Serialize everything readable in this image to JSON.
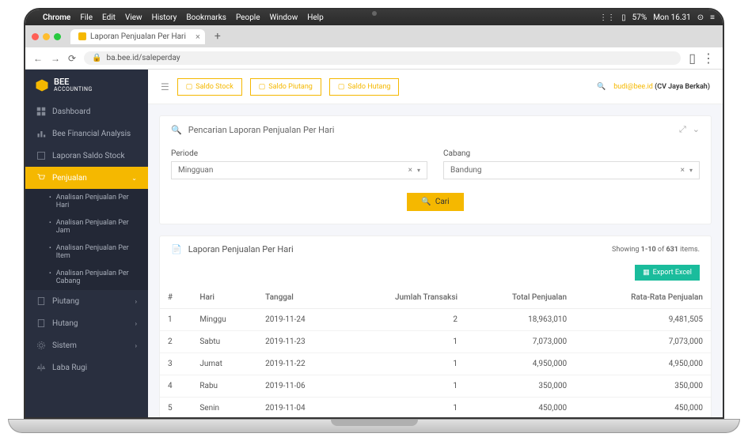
{
  "menubar": {
    "items": [
      "Chrome",
      "File",
      "Edit",
      "View",
      "History",
      "Bookmarks",
      "People",
      "Window",
      "Help"
    ],
    "battery": "57%",
    "time": "Mon 16.31"
  },
  "browser": {
    "tab_title": "Laporan Penjualan Per Hari",
    "url": "ba.bee.id/saleperday"
  },
  "brand": {
    "name": "BEE",
    "sub": "ACCOUNTING"
  },
  "sidebar": {
    "items": [
      {
        "label": "Dashboard"
      },
      {
        "label": "Bee Financial Analysis"
      },
      {
        "label": "Laporan Saldo Stock"
      },
      {
        "label": "Penjualan",
        "active": true,
        "children": [
          {
            "label": "Analisan Penjualan Per Hari"
          },
          {
            "label": "Analisan Penjualan Per Jam"
          },
          {
            "label": "Analisan Penjualan Per Item"
          },
          {
            "label": "Analisan Penjualan Per Cabang"
          }
        ]
      },
      {
        "label": "Piutang"
      },
      {
        "label": "Hutang"
      },
      {
        "label": "Sistem"
      },
      {
        "label": "Laba Rugi"
      }
    ]
  },
  "topbar": {
    "buttons": [
      {
        "label": "Saldo Stock"
      },
      {
        "label": "Saldo Piutang"
      },
      {
        "label": "Saldo Hutang"
      }
    ],
    "user_email": "budi@bee.id",
    "user_company": "(CV Jaya Berkah)"
  },
  "search_card": {
    "title": "Pencarian Laporan Penjualan Per Hari",
    "periode_label": "Periode",
    "periode_value": "Mingguan",
    "cabang_label": "Cabang",
    "cabang_value": "Bandung",
    "cari_label": "Cari"
  },
  "results": {
    "title": "Laporan Penjualan Per Hari",
    "showing_prefix": "Showing ",
    "showing_range": "1-10",
    "showing_mid": " of ",
    "showing_total": "631",
    "showing_suffix": " items.",
    "export_label": "Export Excel",
    "columns": [
      "#",
      "Hari",
      "Tanggal",
      "Jumlah Transaksi",
      "Total Penjualan",
      "Rata-Rata Penjualan"
    ],
    "rows": [
      {
        "n": "1",
        "hari": "Minggu",
        "tanggal": "2019-11-24",
        "jt": "2",
        "tp": "18,963,010",
        "rr": "9,481,505"
      },
      {
        "n": "2",
        "hari": "Sabtu",
        "tanggal": "2019-11-23",
        "jt": "1",
        "tp": "7,073,000",
        "rr": "7,073,000"
      },
      {
        "n": "3",
        "hari": "Jumat",
        "tanggal": "2019-11-22",
        "jt": "1",
        "tp": "4,950,000",
        "rr": "4,950,000"
      },
      {
        "n": "4",
        "hari": "Rabu",
        "tanggal": "2019-11-06",
        "jt": "1",
        "tp": "350,000",
        "rr": "350,000"
      },
      {
        "n": "5",
        "hari": "Senin",
        "tanggal": "2019-11-04",
        "jt": "1",
        "tp": "450,000",
        "rr": "450,000"
      }
    ]
  }
}
